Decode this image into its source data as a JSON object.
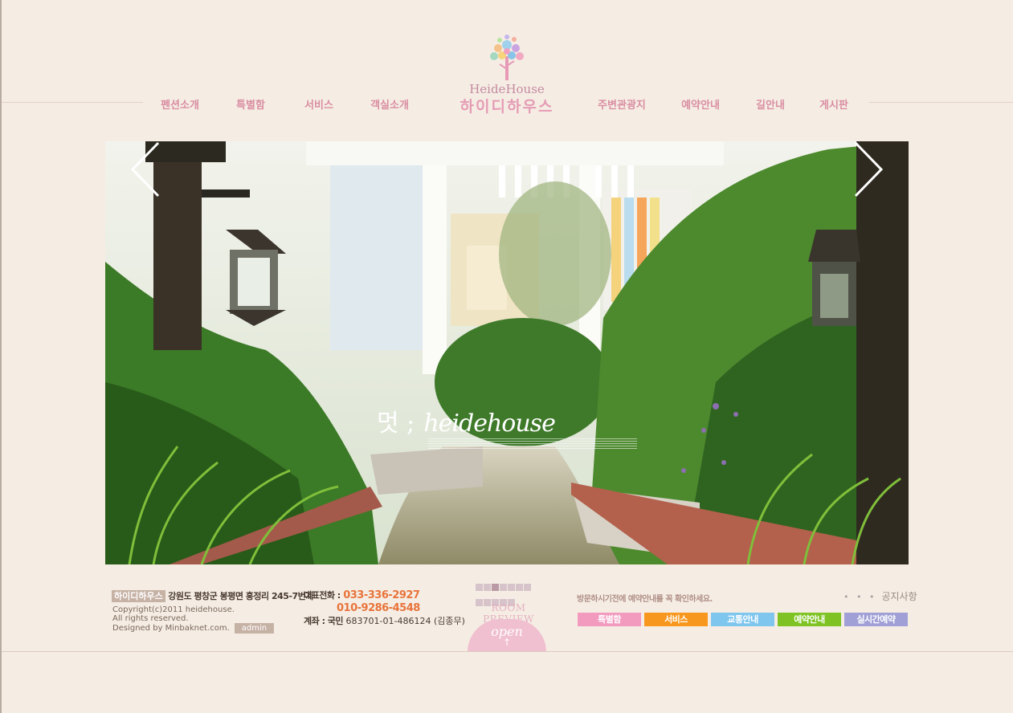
{
  "nav": {
    "left": [
      "펜션소개",
      "특별함",
      "서비스",
      "객실소개"
    ],
    "right": [
      "주변관광지",
      "예약안내",
      "길안내",
      "게시판"
    ]
  },
  "logo": {
    "en": "HeideHouse",
    "ko": "하이디하우스"
  },
  "hero": {
    "caption_mark": "멋 ;",
    "caption_script": "heidehouse",
    "prev_icon": "chevron-left-icon",
    "next_icon": "chevron-right-icon"
  },
  "footer": {
    "brand": "하이디하우스",
    "address": "강원도 평창군 봉평면 흥정리 245-7번지",
    "copyright": "Copyright(c)2011  heidehouse.",
    "rights": "All rights reserved.",
    "designed": "Designed by Minbaknet.com.",
    "admin": "admin",
    "tel_label": "대표전화 :",
    "tel1": "033-336-2927",
    "tel2": "010-9286-4548",
    "account_label": "계좌 : 국민",
    "account": "683701-01-486124 (김종무)"
  },
  "preview": {
    "title": "ROOM PREVIEW",
    "open": "open",
    "arrow": "↑"
  },
  "notice": {
    "text": "방문하시기전에 예약안내를 꼭 확인하세요.",
    "dots": "• • •",
    "link": "공지사항"
  },
  "quick_links": [
    {
      "label": "특별함",
      "color": "#f29bbf"
    },
    {
      "label": "서비스",
      "color": "#f7971e"
    },
    {
      "label": "교통안내",
      "color": "#7fc6ee"
    },
    {
      "label": "예약안내",
      "color": "#7ec323"
    },
    {
      "label": "실시간예약",
      "color": "#a0a0d6"
    }
  ]
}
